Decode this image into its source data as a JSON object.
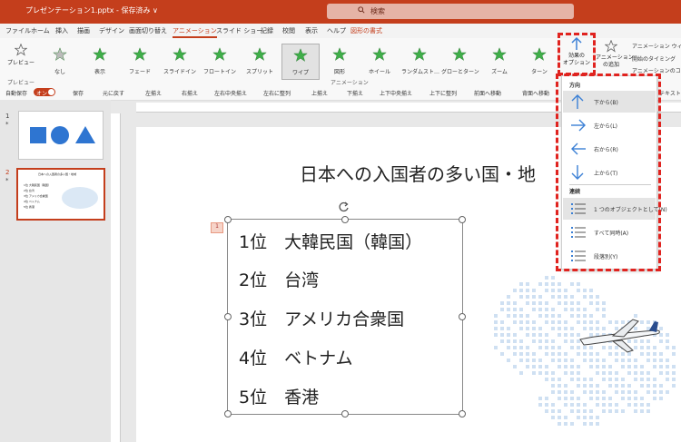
{
  "titlebar": {
    "file": "プレゼンテーション1.pptx - 保存済み ∨",
    "search_placeholder": "検索"
  },
  "tabs": [
    "ファイル",
    "ホーム",
    "挿入",
    "描画",
    "デザイン",
    "画面切り替え",
    "アニメーション",
    "スライド ショー",
    "記録",
    "校閲",
    "表示",
    "ヘルプ",
    "図形の書式"
  ],
  "ribbon": {
    "preview_label": "プレビュー",
    "preview_group": "プレビュー",
    "animation_group": "アニメーション",
    "effects": [
      "なし",
      "表示",
      "フェード",
      "スライドイン",
      "フロートイン",
      "スプリット",
      "ワイプ",
      "図形",
      "ホイール",
      "ランダムスト…",
      "グローとターン",
      "ズーム",
      "ターン"
    ],
    "effect_options_label": "効果の\nオプション",
    "add_animation_label": "アニメーション\nの追加",
    "side_items": [
      "アニメーション ウィ",
      "開始のタイミング",
      "アニメーションのコ",
      "詳細設定",
      "テキスト"
    ]
  },
  "quickbar": {
    "autosave": "自動保存",
    "toggle": "オン",
    "items": [
      "保存",
      "元に戻す",
      "左揃え",
      "右揃え",
      "左右中央揃え",
      "左右に整列",
      "上揃え",
      "下揃え",
      "上下中央揃え",
      "上下に整列",
      "前面へ移動",
      "背面へ移動"
    ]
  },
  "slides_panel": {
    "numbers": [
      "1",
      "2"
    ],
    "star": "*"
  },
  "slide": {
    "title": "日本への入国者の多い国・地",
    "anim_tag": "1",
    "ranking": [
      "1位　大韓民国（韓国）",
      "2位　台湾",
      "3位　アメリカ合衆国",
      "4位　ベトナム",
      "5位　香港"
    ]
  },
  "thumb2_lines": [
    "日本への入国者の多い国・地域",
    "1位 大韓民国（韓国）",
    "2位 台湾",
    "3位 アメリカ合衆国",
    "4位 ベトナム",
    "5位 香港"
  ],
  "dropdown": {
    "section_direction": "方向",
    "directions": [
      "下から(B)",
      "左から(L)",
      "右から(R)",
      "上から(T)"
    ],
    "section_sequence": "連続",
    "sequences": [
      "1 つのオブジェクトとして(N)",
      "すべて同時(A)",
      "段落別(Y)"
    ]
  },
  "colors": {
    "accent": "#c43e1c",
    "highlight": "#e0231f",
    "arrow_blue": "#3a7fd5"
  }
}
